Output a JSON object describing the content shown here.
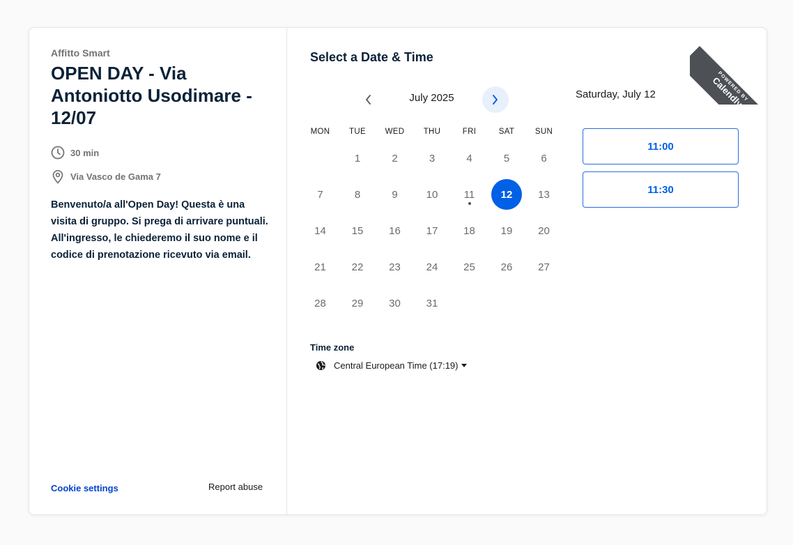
{
  "organizer": "Affitto Smart",
  "event": {
    "title": "OPEN DAY - Via Antoniotto Usodimare - 12/07",
    "duration": "30 min",
    "location": "Via Vasco de Gama 7",
    "description": "Benvenuto/a all'Open Day! Questa è una visita di gruppo. Si prega di arrivare puntuali. All'ingresso, le chiederemo il suo nome e il codice di prenotazione ricevuto via email."
  },
  "footer": {
    "cookie_settings": "Cookie settings",
    "report_abuse": "Report abuse"
  },
  "calendar": {
    "heading": "Select a Date & Time",
    "month_label": "July 2025",
    "weekdays": [
      "MON",
      "TUE",
      "WED",
      "THU",
      "FRI",
      "SAT",
      "SUN"
    ],
    "days": [
      "1",
      "2",
      "3",
      "4",
      "5",
      "6",
      "7",
      "8",
      "9",
      "10",
      "11",
      "12",
      "13",
      "14",
      "15",
      "16",
      "17",
      "18",
      "19",
      "20",
      "21",
      "22",
      "23",
      "24",
      "25",
      "26",
      "27",
      "28",
      "29",
      "30",
      "31"
    ],
    "selected_day": "12",
    "today_day": "11"
  },
  "timezone": {
    "label": "Time zone",
    "value": "Central European Time (17:19)"
  },
  "slots": {
    "date_heading": "Saturday, July 12",
    "times": [
      "11:00",
      "11:30"
    ]
  },
  "badge": {
    "small": "POWERED BY",
    "brand": "Calendly"
  },
  "colors": {
    "accent": "#0060e6",
    "accent_light": "#e8f0fc",
    "title_text": "#0b2238",
    "ribbon": "#4d5055"
  },
  "icons": {
    "duration": "clock-icon",
    "location": "location-pin-icon",
    "timezone": "globe-icon",
    "prev": "chevron-left-icon",
    "next": "chevron-right-icon",
    "dropdown": "caret-down-icon"
  }
}
